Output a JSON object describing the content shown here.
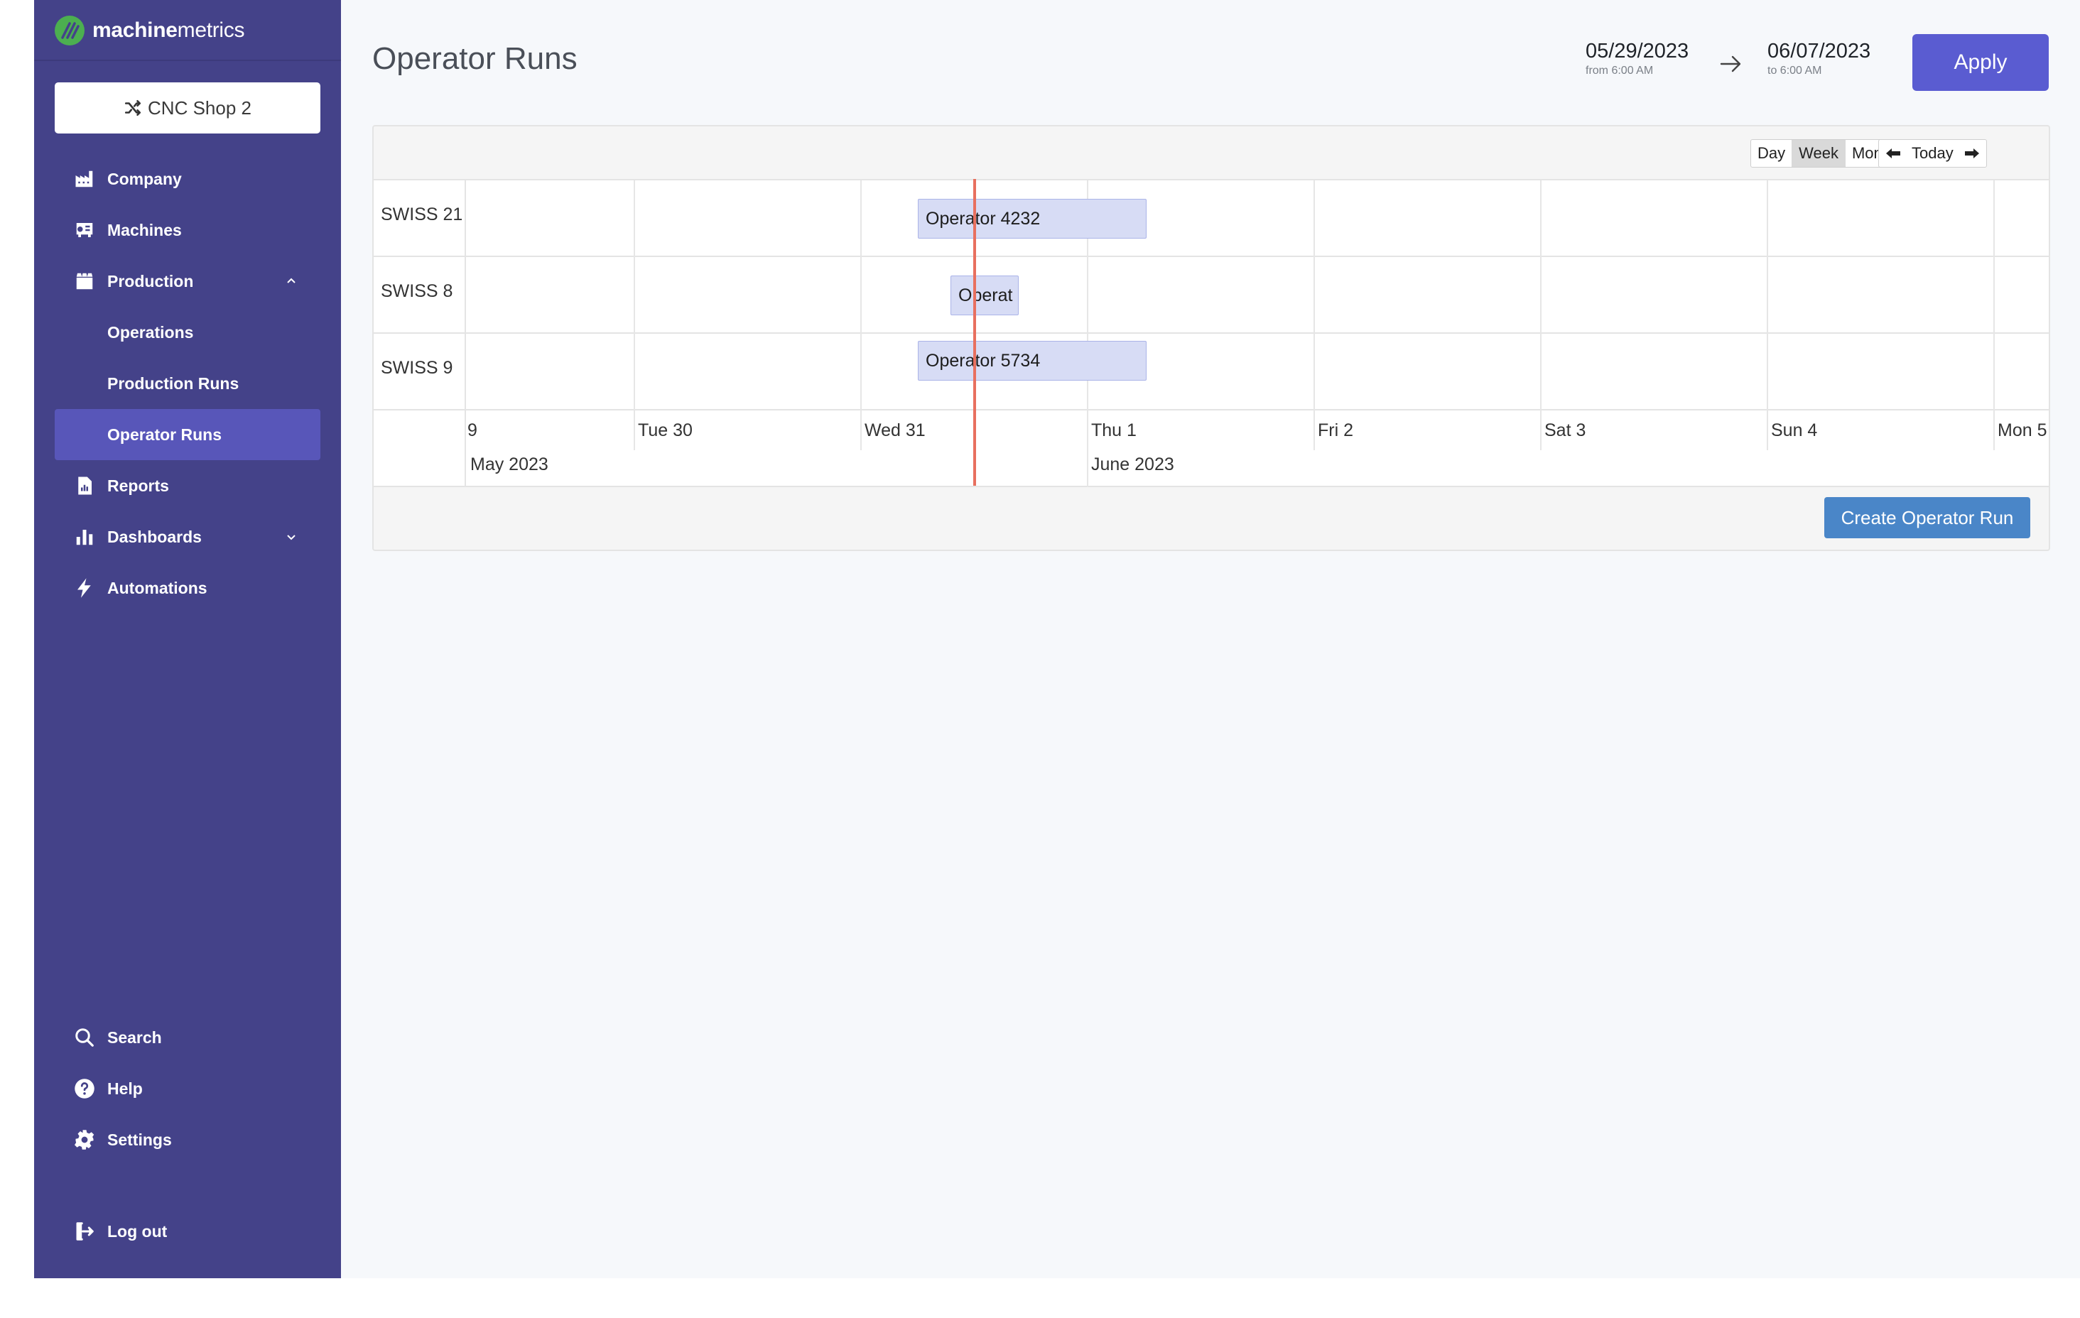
{
  "app": {
    "brand_bold": "machine",
    "brand_rest": "metrics",
    "brand_color": "#4caf50"
  },
  "sidebar": {
    "shop_button": "CNC Shop 2",
    "items": [
      {
        "label": "Company",
        "icon": "factory-icon"
      },
      {
        "label": "Machines",
        "icon": "machine-icon"
      },
      {
        "label": "Production",
        "icon": "production-icon",
        "expanded": true
      },
      {
        "label": "Operations"
      },
      {
        "label": "Production Runs"
      },
      {
        "label": "Operator Runs",
        "active": true
      },
      {
        "label": "Reports",
        "icon": "report-icon"
      },
      {
        "label": "Dashboards",
        "icon": "bar-chart-icon",
        "expanded": false
      },
      {
        "label": "Automations",
        "icon": "lightning-icon"
      }
    ],
    "bottom_items": [
      {
        "label": "Search",
        "icon": "search-icon"
      },
      {
        "label": "Help",
        "icon": "help-icon"
      },
      {
        "label": "Settings",
        "icon": "gear-icon"
      },
      {
        "label": "Log out",
        "icon": "logout-icon"
      }
    ],
    "bg_color": "#444289",
    "active_color": "#5856b9"
  },
  "header": {
    "title": "Operator Runs",
    "date_from": "05/29/2023",
    "date_from_sub": "from 6:00 AM",
    "date_to": "06/07/2023",
    "date_to_sub": "to 6:00 AM",
    "apply_label": "Apply",
    "apply_color": "#5a5cd1"
  },
  "timeline": {
    "view_buttons": [
      "Day",
      "Week",
      "Month"
    ],
    "active_view": "Week",
    "today_label": "Today",
    "groups": [
      "SWISS 21",
      "SWISS 8",
      "SWISS 9"
    ],
    "runs": [
      {
        "group": "SWISS 21",
        "label": "Operator 4232"
      },
      {
        "group": "SWISS 8",
        "label": "Operat"
      },
      {
        "group": "SWISS 9",
        "label": "Operator 5734"
      }
    ],
    "day_labels": [
      "9",
      "Tue 30",
      "Wed 31",
      "Thu 1",
      "Fri 2",
      "Sat 3",
      "Sun 4",
      "Mon 5"
    ],
    "month_labels": [
      "May 2023",
      "June 2023"
    ],
    "current_time_color": "#e8705f",
    "create_label": "Create Operator Run",
    "create_color": "#4a86c8"
  }
}
